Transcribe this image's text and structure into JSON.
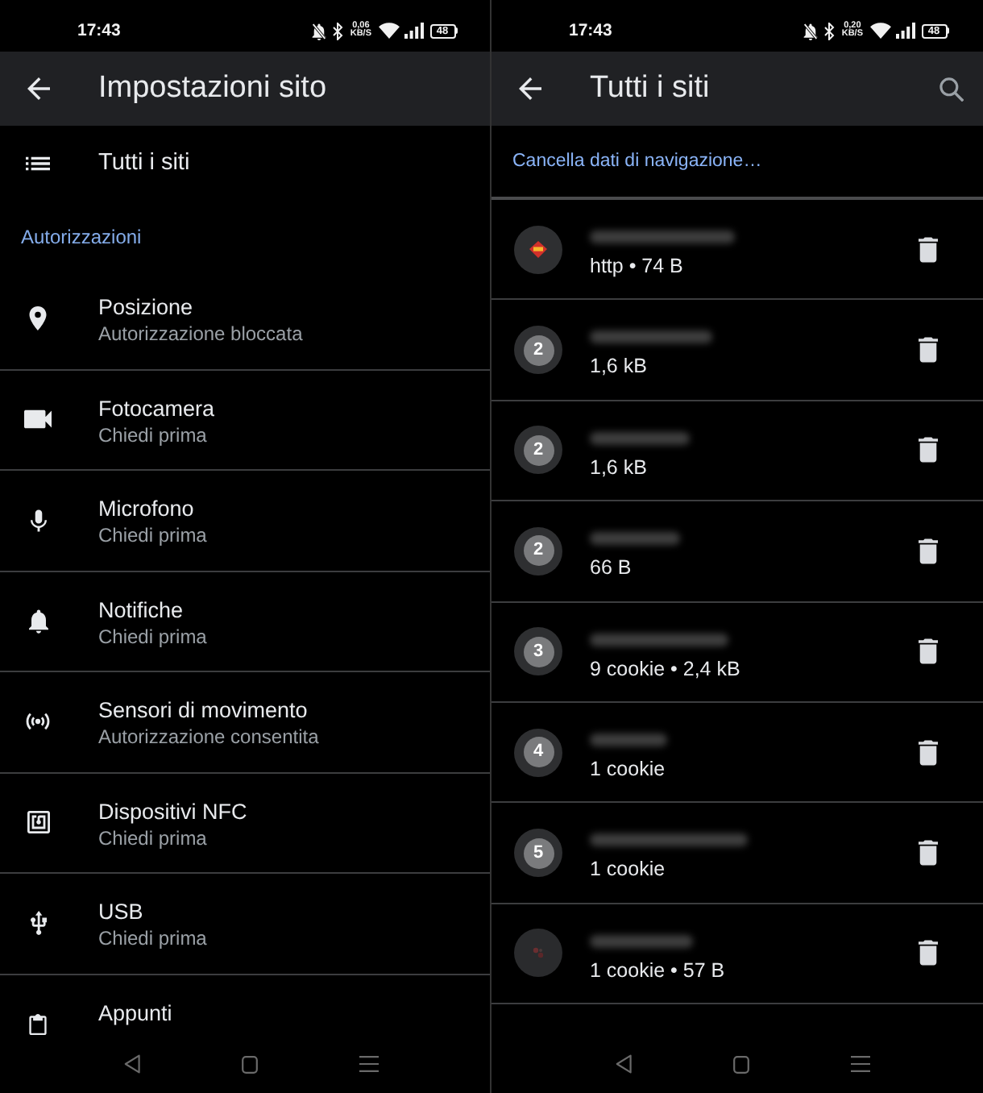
{
  "settings_screen": {
    "status_bar": {
      "time": "17:43",
      "speed": "0,06",
      "speed_unit": "KB/S",
      "battery": "48"
    },
    "app_bar": {
      "title": "Impostazioni sito"
    },
    "all_sites_item": {
      "label": "Tutti i siti"
    },
    "section_title": "Autorizzazioni",
    "permissions": [
      {
        "name": "Posizione",
        "status": "Autorizzazione bloccata"
      },
      {
        "name": "Fotocamera",
        "status": "Chiedi prima"
      },
      {
        "name": "Microfono",
        "status": "Chiedi prima"
      },
      {
        "name": "Notifiche",
        "status": "Chiedi prima"
      },
      {
        "name": "Sensori di movimento",
        "status": "Autorizzazione consentita"
      },
      {
        "name": "Dispositivi NFC",
        "status": "Chiedi prima"
      },
      {
        "name": "USB",
        "status": "Chiedi prima"
      },
      {
        "name": "Appunti"
      }
    ]
  },
  "sites_screen": {
    "status_bar": {
      "time": "17:43",
      "speed": "0,20",
      "speed_unit": "KB/S",
      "battery": "48"
    },
    "app_bar": {
      "title": "Tutti i siti"
    },
    "clear_data_link": "Cancella dati di navigazione…",
    "sites": [
      {
        "kind": "favicon",
        "name_blurred": true,
        "details": "http • 74 B"
      },
      {
        "kind": "count",
        "count": "2",
        "name_blurred": true,
        "details": "1,6 kB"
      },
      {
        "kind": "count",
        "count": "2",
        "name_blurred": true,
        "details": "1,6 kB"
      },
      {
        "kind": "count",
        "count": "2",
        "name_blurred": true,
        "details": "66 B"
      },
      {
        "kind": "count",
        "count": "3",
        "name_blurred": true,
        "details": "9 cookie • 2,4 kB"
      },
      {
        "kind": "count",
        "count": "4",
        "name_blurred": true,
        "details": "1 cookie"
      },
      {
        "kind": "count",
        "count": "5",
        "name_blurred": true,
        "details": "1 cookie"
      },
      {
        "kind": "favicon",
        "name_blurred": true,
        "details": "1 cookie • 57 B"
      }
    ]
  }
}
